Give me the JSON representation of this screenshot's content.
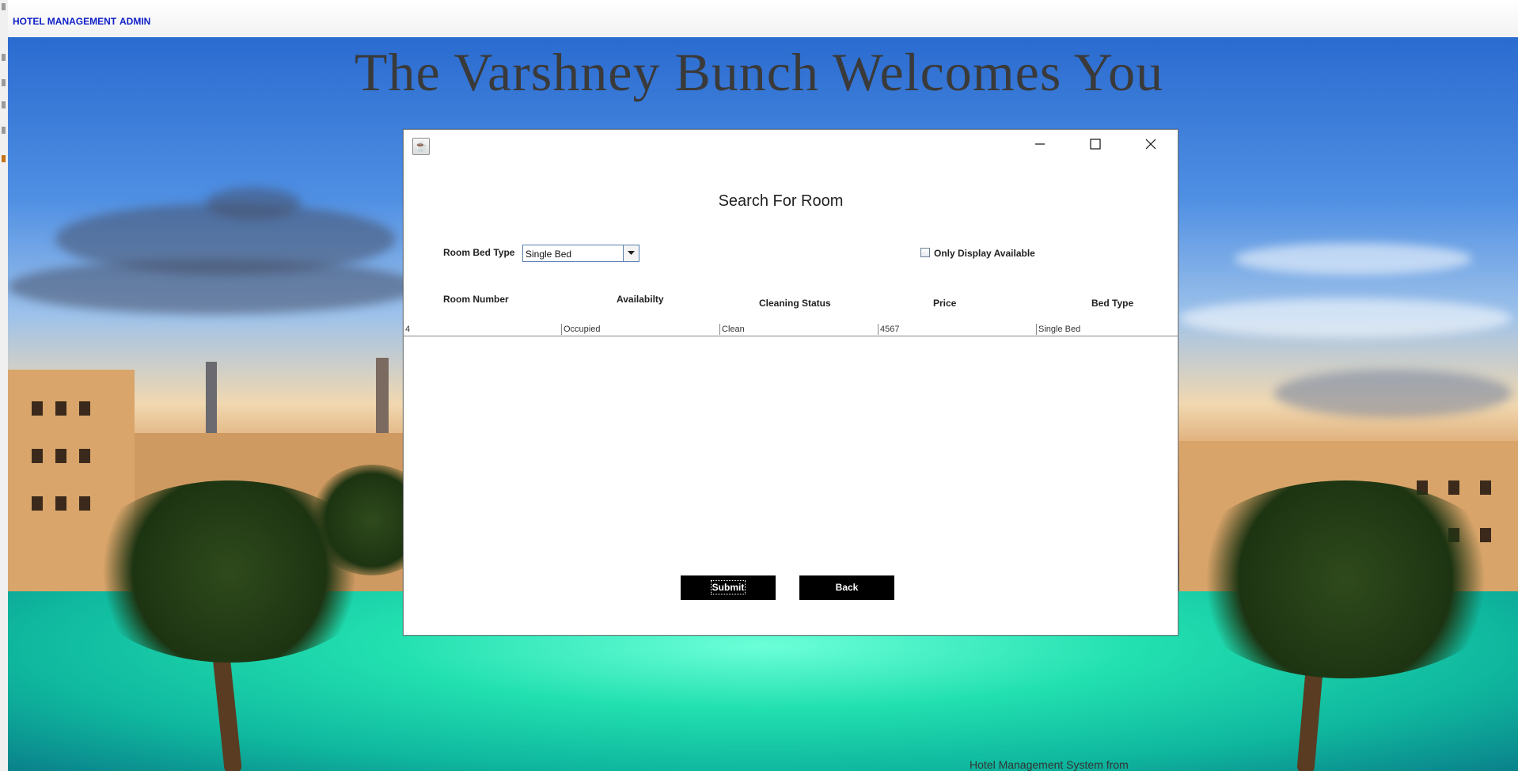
{
  "menubar": {
    "items": [
      {
        "label": "HOTEL MANAGEMENT"
      },
      {
        "label": "ADMIN"
      }
    ]
  },
  "background": {
    "welcome_text": "The Varshney Bunch Welcomes You",
    "status_text": "Hotel Management System from"
  },
  "dialog": {
    "title": "Search For Room",
    "icon": "java-icon",
    "window_controls": [
      "minimize-icon",
      "maximize-icon",
      "close-icon"
    ],
    "filters": {
      "bed_type_label": "Room Bed Type",
      "bed_type_selected": "Single Bed",
      "available_checkbox_label": "Only Display Available",
      "available_checked": false
    },
    "table": {
      "columns": [
        "Room Number",
        "Availabilty",
        "Cleaning Status",
        "Price",
        "Bed Type"
      ],
      "rows": [
        [
          "4",
          "Occupied",
          "Clean",
          "4567",
          "Single Bed"
        ]
      ]
    },
    "buttons": {
      "submit": "Submit",
      "back": "Back"
    }
  }
}
